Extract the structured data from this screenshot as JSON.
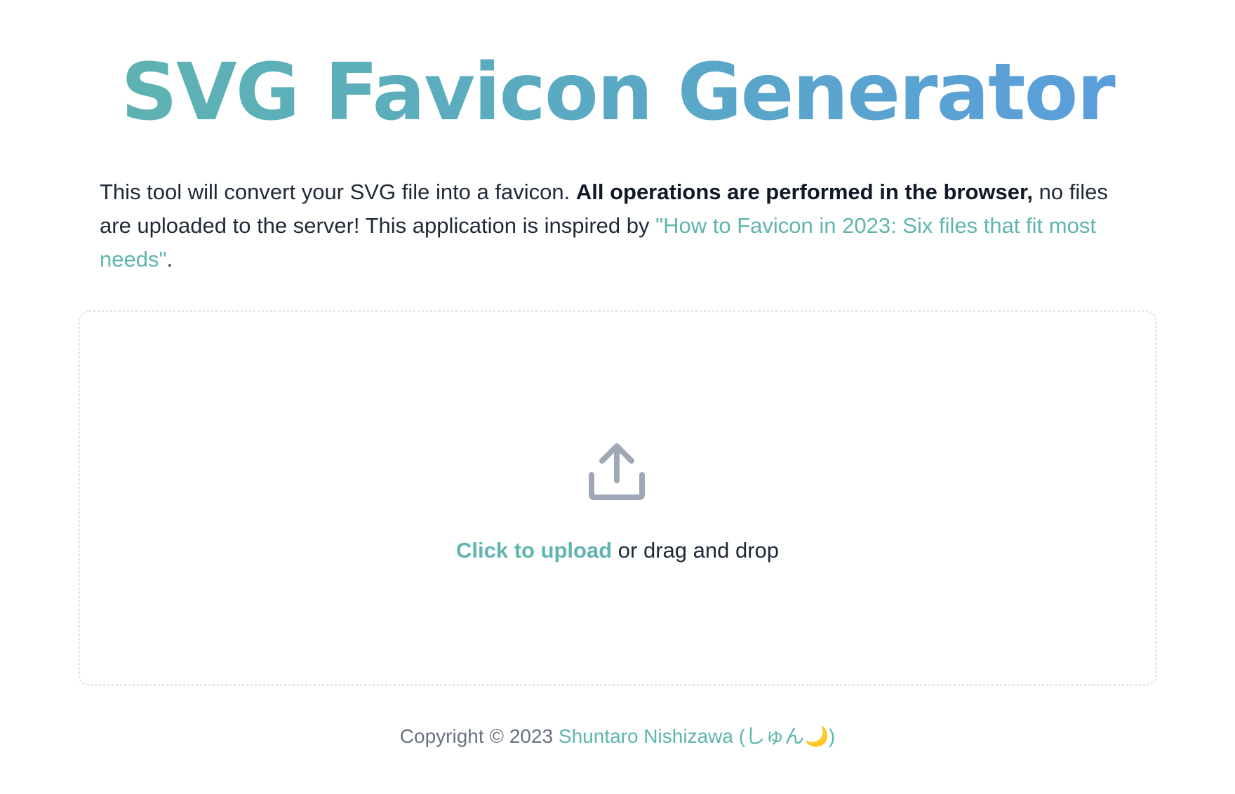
{
  "header": {
    "title": "SVG Favicon Generator",
    "gradient_start": "#5fb5ae",
    "gradient_end": "#5b9be2"
  },
  "intro": {
    "text_1": "This tool will convert your SVG file into a favicon. ",
    "bold": "All operations are performed in the browser,",
    "text_2": " no files are uploaded to the server! This application is inspired by ",
    "link": "\"How to Favicon in 2023: Six files that fit most needs\"",
    "text_3": "."
  },
  "dropzone": {
    "icon": "upload-icon",
    "cta": "Click to upload",
    "rest": " or drag and drop"
  },
  "footer": {
    "prefix": "Copyright © 2023 ",
    "author": "Shuntaro Nishizawa (しゅん🌙)"
  },
  "colors": {
    "accent": "#5fb5ae",
    "text": "#1f2937",
    "muted": "#6b7280",
    "icon": "#a0a8b7",
    "border": "#e5e7eb"
  }
}
